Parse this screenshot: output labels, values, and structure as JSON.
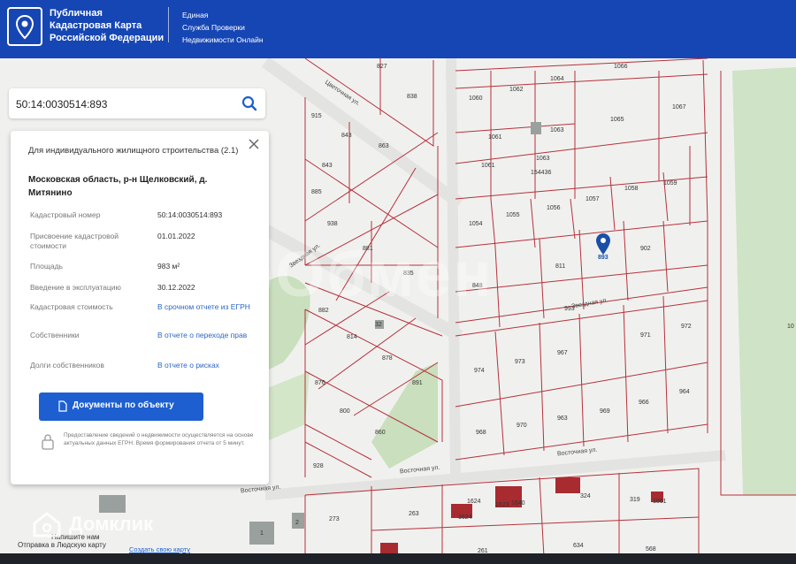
{
  "header": {
    "title_lines": [
      "Публичная",
      "Кадастровая Карта",
      "Российской Федерации"
    ],
    "subtitle_lines": [
      "Единая",
      "Служба Проверки",
      "Недвижимости Онлайн"
    ]
  },
  "search": {
    "value": "50:14:0030514:893"
  },
  "card": {
    "title": "Для индивидуального жилищного строительства (2.1)",
    "address": "Московская область, р-н Щелковский, д. Митянино",
    "properties": [
      {
        "label": "Кадастровый номер",
        "value": "50:14:0030514:893"
      },
      {
        "label": "Присвоение кадастровой стоимости",
        "value": "01.01.2022"
      },
      {
        "label": "Площадь",
        "value": "983 м²"
      },
      {
        "label": "Введение в эксплуатацию",
        "value": "30.12.2022"
      },
      {
        "label": "Кадастровая стоимость",
        "value": "В срочном отчете из ЕГРН"
      },
      {
        "label": "Собственники",
        "value": "В отчете о переходе прав"
      },
      {
        "label": "Долги собственников",
        "value": "В отчете о рисках"
      }
    ],
    "docs_button": "Документы по объекту",
    "notice": "Предоставление сведений о недвижимости осуществляется на основе актуальных данных ЕГРН. Время формирования отчета от 5 минут."
  },
  "footer": {
    "login": "Напишите нам",
    "text": "Отправка в Людскую карту",
    "link": "Создать свою карту"
  },
  "watermarks": {
    "center": "ГорОбмен",
    "brand": "Домклик"
  },
  "map": {
    "streets": [
      "Цветочная ул.",
      "Звездная ул.",
      "Звездная ул.",
      "Восточная ул.",
      "Восточная ул."
    ],
    "parcels": [
      "827",
      "838",
      "915",
      "843",
      "863",
      "843",
      "885",
      "938",
      "881",
      "835",
      "882",
      "814",
      "32",
      "878",
      "876",
      "891",
      "800",
      "860",
      "928",
      "1066",
      "1060",
      "1062",
      "1064",
      "1065",
      "1067",
      "1061",
      "1063",
      "1061",
      "1063",
      "154436",
      "1054",
      "1055",
      "1056",
      "1057",
      "1058",
      "1059",
      "848",
      "811",
      "893",
      "902",
      "993",
      "974",
      "973",
      "967",
      "971",
      "972",
      "968",
      "970",
      "963",
      "969",
      "966",
      "964",
      "273",
      "263",
      "1624",
      "1623",
      "1640",
      "1624",
      "324",
      "319",
      "1001",
      "261",
      "634",
      "568",
      "1",
      "2",
      "10"
    ]
  },
  "colors": {
    "header": "#1646b4",
    "parcel_line": "#b8303a",
    "button": "#1d5fd0",
    "marker": "#1a4fa8"
  }
}
